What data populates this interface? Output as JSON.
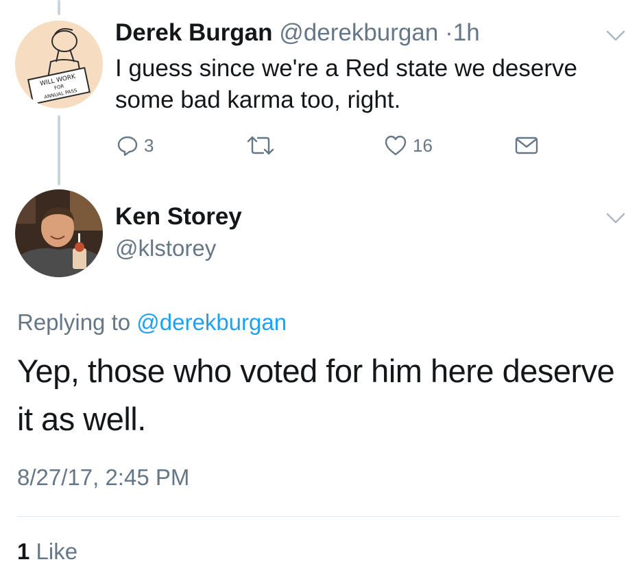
{
  "tweet1": {
    "display_name": "Derek Burgan",
    "handle": "@derekburgan",
    "separator": "·",
    "time": "1h",
    "text": "I guess since we're a Red state we deserve some bad karma too, right.",
    "avatar_sign_text": [
      "WILL WORK",
      "FOR",
      "ANNUAL PASS"
    ],
    "actions": {
      "reply_count": "3",
      "retweet_count": "",
      "like_count": "16"
    }
  },
  "tweet2": {
    "display_name": "Ken Storey",
    "handle": "@klstorey",
    "replying_prefix": "Replying to",
    "replying_handle": "@derekburgan",
    "text": "Yep, those who voted for him here deserve it as well.",
    "timestamp": "8/27/17, 2:45 PM",
    "likes_count": "1",
    "likes_label": "Like"
  },
  "colors": {
    "text": "#14171a",
    "muted": "#657786",
    "link": "#1da1f2",
    "thread_line": "#c9d4dd",
    "divider": "#e1e8ed"
  },
  "icons": [
    "reply-icon",
    "retweet-icon",
    "like-icon",
    "direct-message-icon",
    "chevron-down-icon"
  ]
}
